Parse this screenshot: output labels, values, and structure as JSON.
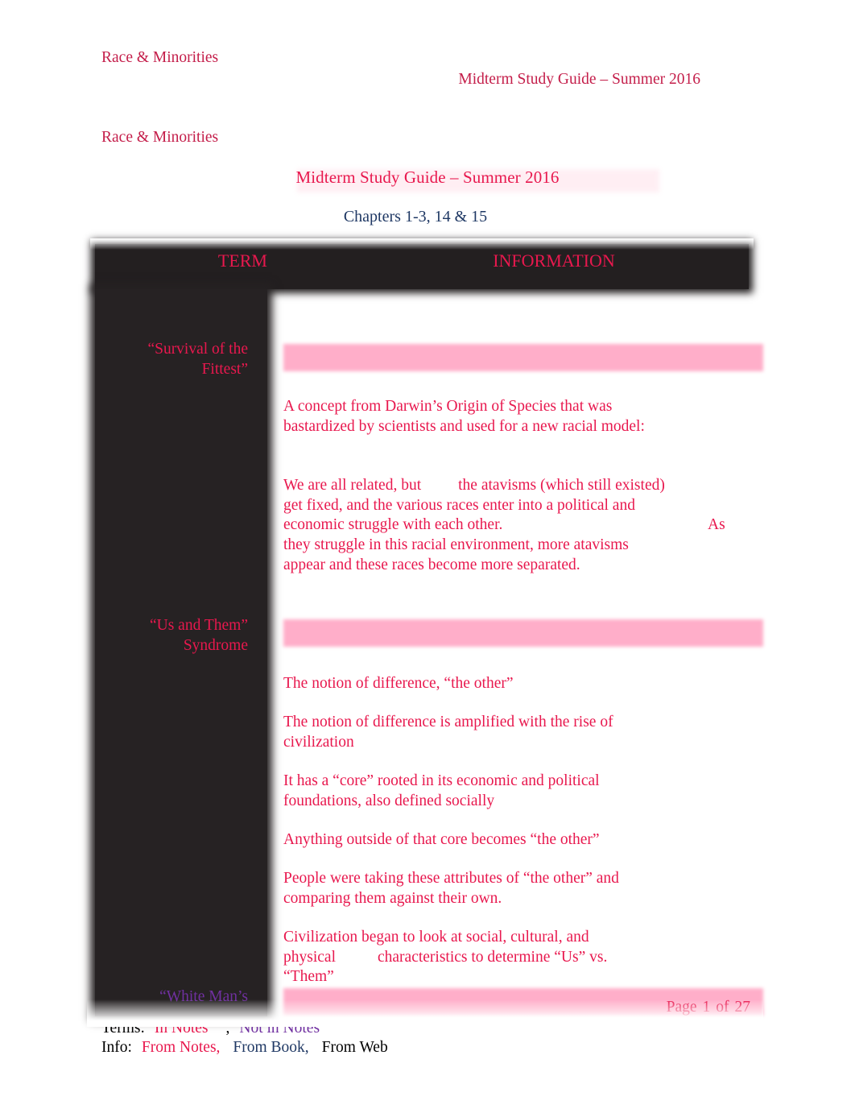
{
  "header": {
    "course": "Race & Minorities",
    "doc_title": "Midterm Study Guide – Summer 2016"
  },
  "title_block": {
    "course": "Race & Minorities",
    "title": "Midterm Study Guide – Summer 2016",
    "chapters": "Chapters 1-3, 14 & 15"
  },
  "table": {
    "columns": {
      "term": "TERM",
      "information": "INFORMATION"
    },
    "rows": [
      {
        "term_line1": "“Survival of the",
        "term_line2": "Fittest”",
        "term_color": "#E8184E",
        "paragraphs": [
          {
            "id": "p1",
            "text": "A concept from Darwin’s Origin of Species that was bastardized by scientists and used for a new racial model:"
          },
          {
            "id": "p2a",
            "text": "We are all related, but"
          },
          {
            "id": "p2b",
            "text": "the atavisms (which still existed) get fixed, and the various races enter into a political and economic struggle with each other."
          },
          {
            "id": "p2c",
            "text": "As"
          },
          {
            "id": "p2d",
            "text": "they struggle in this racial environment, more atavisms appear and these races become more separated."
          }
        ]
      },
      {
        "term_line1": "“Us and Them”",
        "term_line2": "Syndrome",
        "term_color": "#E8184E",
        "paragraphs": [
          {
            "id": "q1",
            "text": "The notion of difference, “the other”"
          },
          {
            "id": "q2",
            "text": "The notion of difference is amplified with the rise of civilization"
          },
          {
            "id": "q3",
            "text": "It has a “core” rooted in its economic and political foundations, also defined socially"
          },
          {
            "id": "q4",
            "text": "Anything outside of that core becomes “the other”"
          },
          {
            "id": "q5",
            "text": "People were taking these attributes of “the other” and comparing them against their own."
          },
          {
            "id": "q6a",
            "text": "Civilization began to look at social, cultural, and physical"
          },
          {
            "id": "q6b",
            "text": "characteristics to determine “Us” vs. “Them”"
          }
        ]
      },
      {
        "term_line1": "“White Man’s",
        "term_line2": "",
        "term_color": "#7030A0",
        "paragraphs": []
      }
    ]
  },
  "footer": {
    "page_word": "Page",
    "page_number": "1",
    "of_word": "of",
    "page_total": "27",
    "terms_label": "Terms:",
    "terms_in_notes": "In Notes",
    "terms_comma": ",",
    "terms_not_in_notes": "Not in Notes",
    "info_label": "Info:",
    "info_from_notes": "From Notes,",
    "info_from_book": "From Book,",
    "info_from_web": "From Web"
  },
  "colors": {
    "crimson": "#E8184E",
    "dark_crimson": "#C41E4A",
    "navy": "#1F3864",
    "purple": "#7030A0",
    "pink_highlight": "#FFAEC9",
    "table_dark": "#262223"
  }
}
